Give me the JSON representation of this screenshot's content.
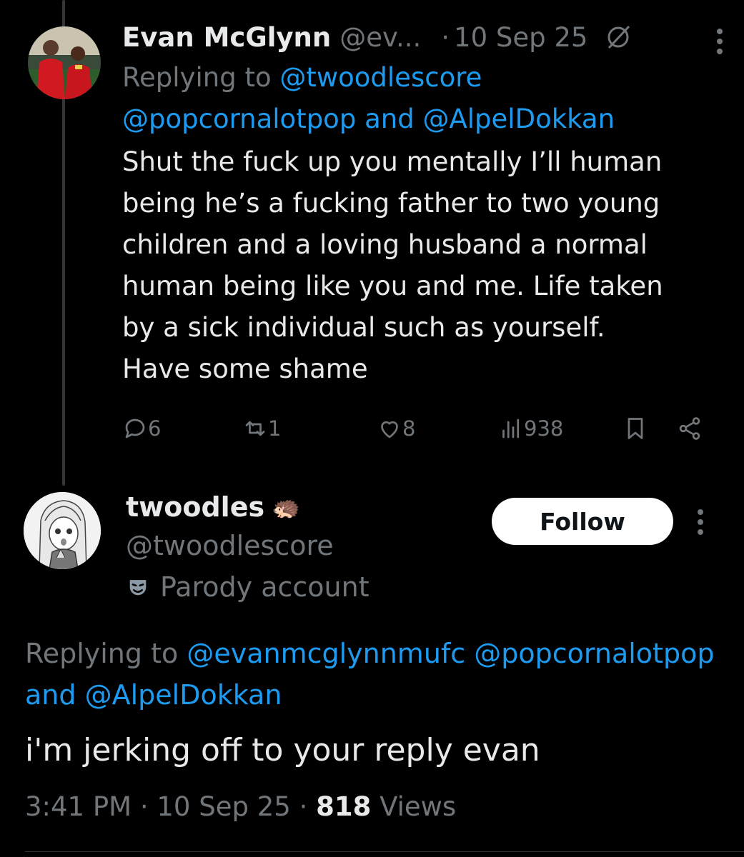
{
  "reply1": {
    "author_name": "Evan McGlynn",
    "author_handle": "@ev...",
    "date": "10 Sep 25",
    "dot": "·",
    "replying_prefix": "Replying to",
    "mention_1": "@twoodlescore",
    "mention_2": "@popcornalotpop",
    "mention_sep": " and ",
    "mention_3": "@AlpelDokkan",
    "body_lines": [
      "Shut the fuck up you mentally I’ll human",
      "being he’s a fucking father to two young",
      "children and a loving husband a normal",
      "human being like you and me. Life taken",
      "by a sick individual such as yourself.",
      "Have some shame"
    ],
    "actions": {
      "replies": "6",
      "reposts": "1",
      "likes": "8",
      "views": "938"
    }
  },
  "reply2": {
    "author_name": "twoodles",
    "author_emoji": "🦔",
    "author_handle": "@twoodlescore",
    "parody_label": "Parody account",
    "follow_label": "Follow",
    "replying_prefix": "Replying to",
    "mention_1": "@evanmcglynnmufc",
    "mention_2": "@popcornalotpop",
    "mention_and": "and",
    "mention_3": "@AlpelDokkan",
    "body": "i'm jerking off to your reply evan",
    "time": "3:41 PM",
    "date": "10 Sep 25",
    "dot": "·",
    "views_count": "818",
    "views_label": "Views"
  },
  "colors": {
    "background": "#000000",
    "text": "#e7e9ea",
    "muted": "#71767b",
    "link": "#1d9bf0",
    "follow_bg": "#ffffff"
  }
}
